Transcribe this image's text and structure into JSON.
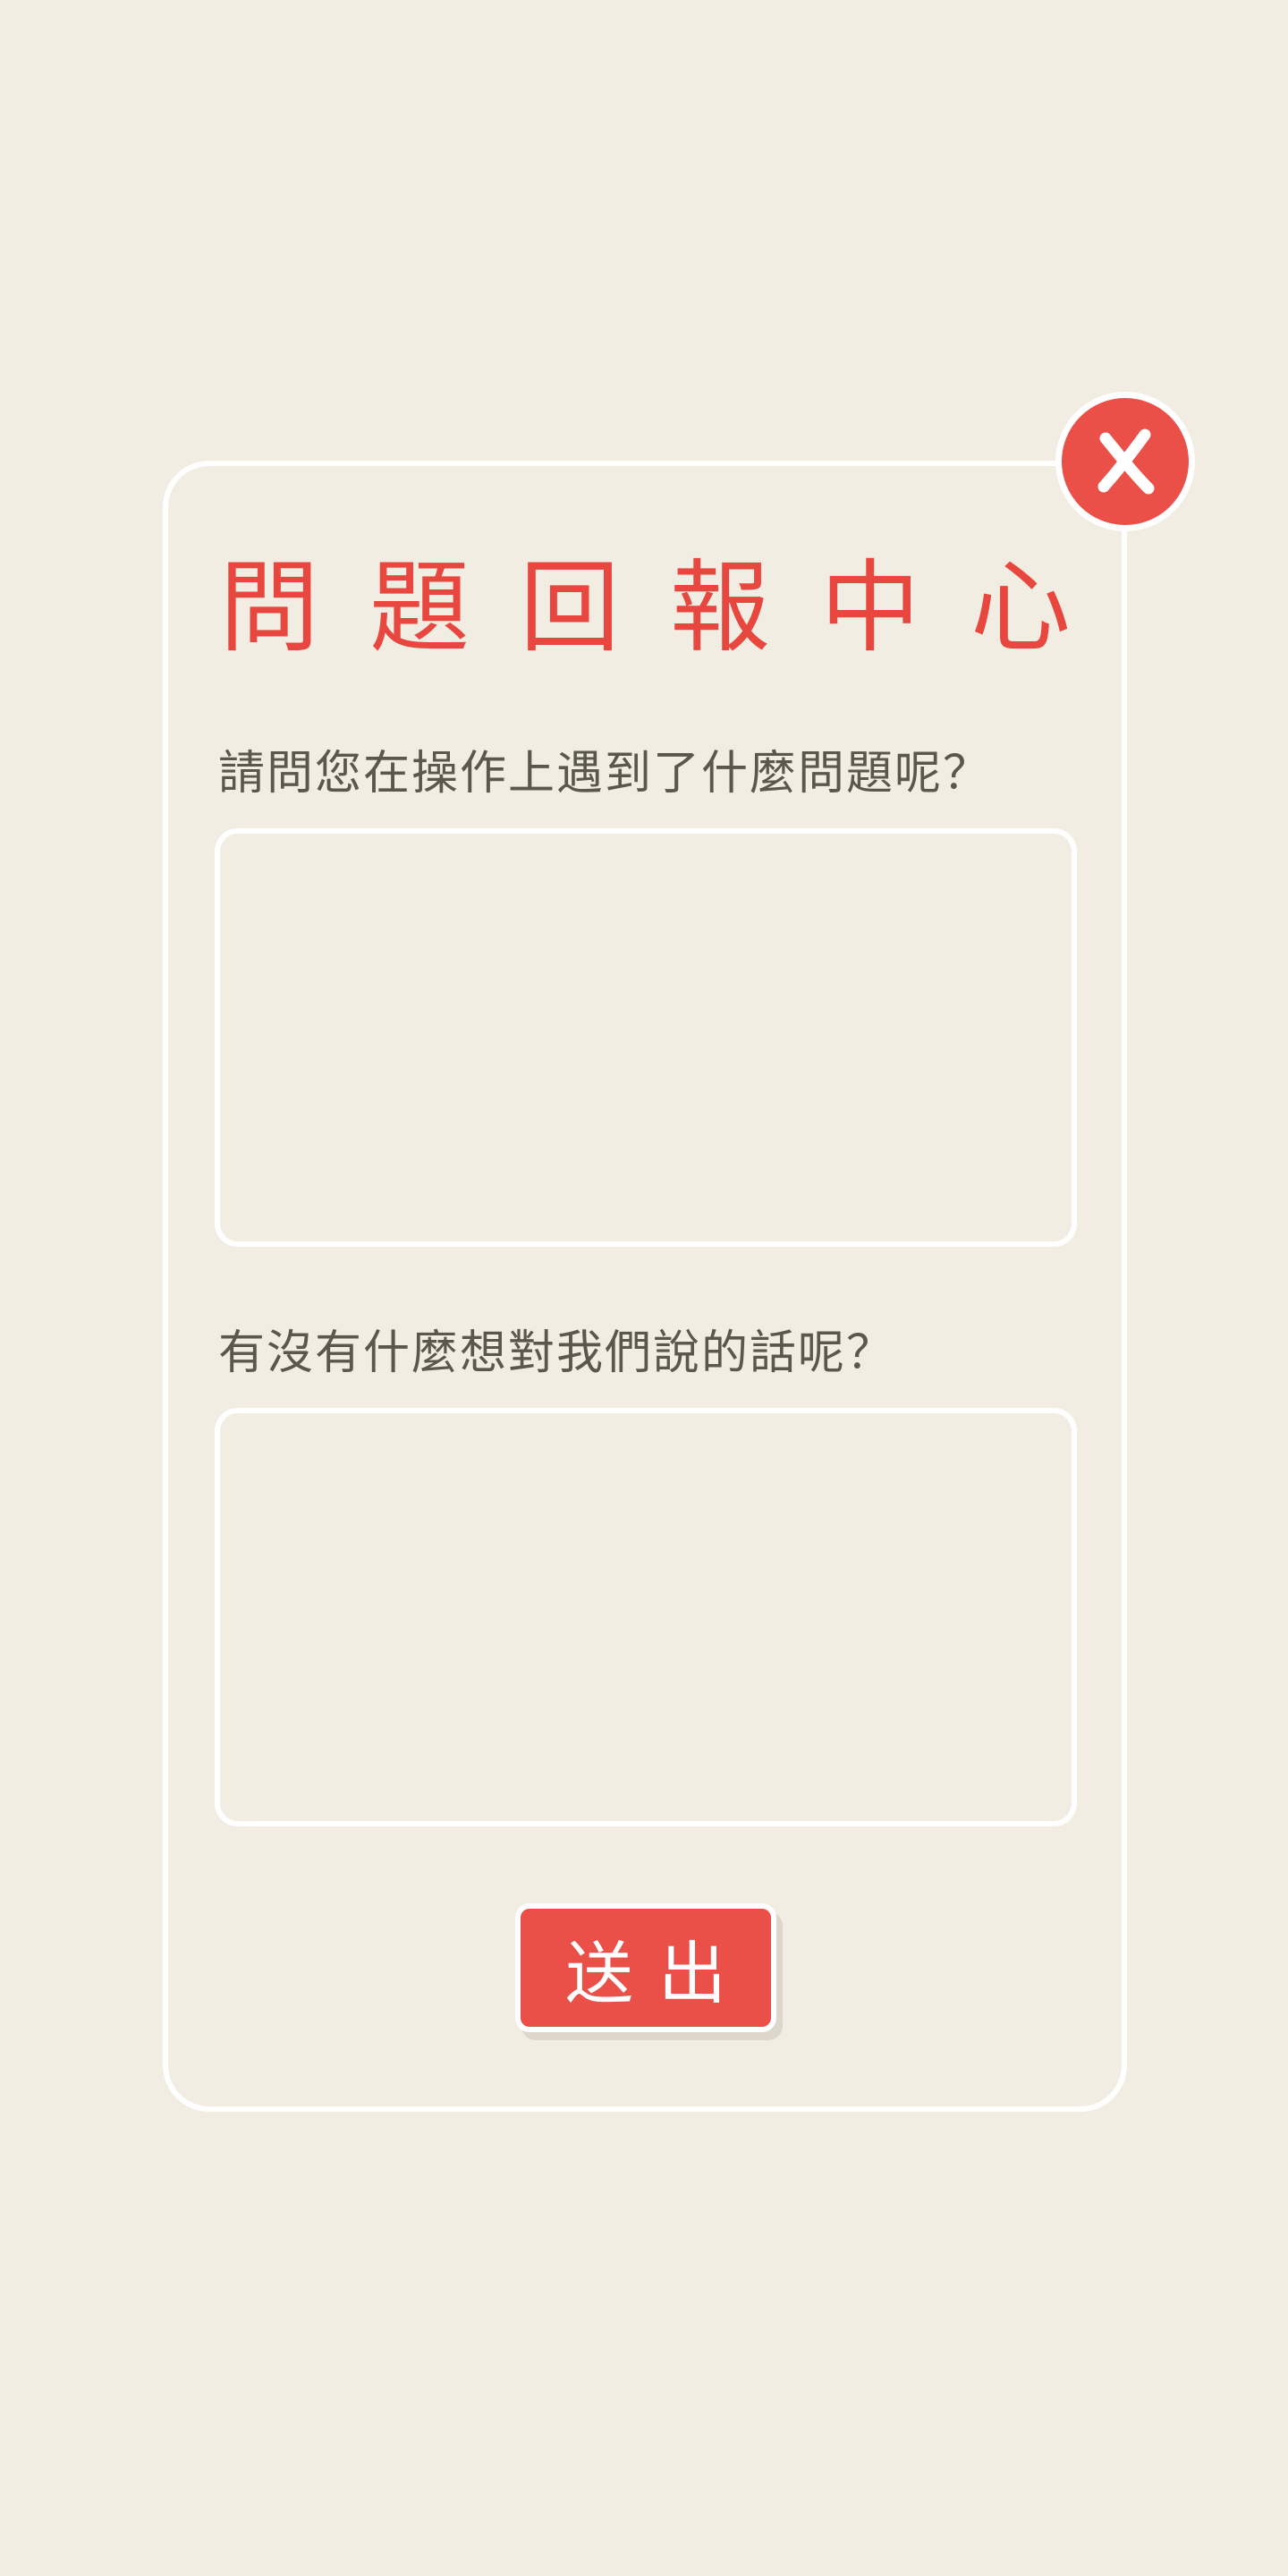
{
  "dialog": {
    "title": "問題回報中心",
    "close_icon": "close-icon",
    "question_1": "請問您在操作上遇到了什麼問題呢？",
    "question_2": "有沒有什麼想對我們說的話呢？",
    "answer_1": "",
    "answer_2": "",
    "submit_label": "送出"
  },
  "colors": {
    "background": "#f2ede3",
    "accent": "#ea4f48",
    "title": "#e8473f",
    "text": "#5a574d",
    "border": "#ffffff"
  }
}
